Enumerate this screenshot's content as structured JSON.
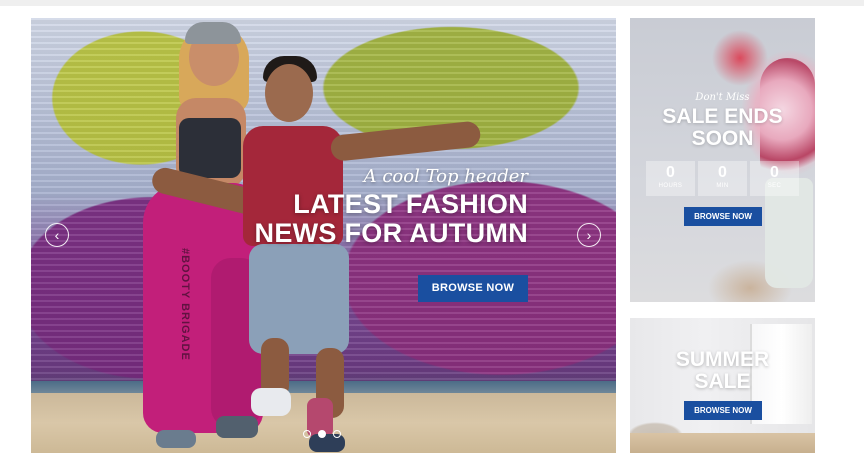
{
  "hero": {
    "subtitle": "A cool Top header",
    "title_line1": "LATEST FASHION",
    "title_line2": "NEWS FOR AUTUMN",
    "button_label": "BROWSE NOW",
    "leg_text": "#BOOTY BRIGADE",
    "prev_icon": "chevron-left-icon",
    "next_icon": "chevron-right-icon",
    "prev_glyph": "‹",
    "next_glyph": "›",
    "slides_total": 3,
    "active_slide": 2
  },
  "sale_banner": {
    "eyebrow": "Don't Miss",
    "title_line1": "SALE ENDS",
    "title_line2": "SOON",
    "countdown": [
      {
        "value": "0",
        "label": "HOURS"
      },
      {
        "value": "0",
        "label": "MIN"
      },
      {
        "value": "0",
        "label": "SEC"
      }
    ],
    "button_label": "BROWSE NOW"
  },
  "summer_banner": {
    "title_line1": "SUMMER",
    "title_line2": "SALE",
    "button_label": "BROWSE NOW"
  },
  "colors": {
    "accent": "#1a4fa0",
    "text_on_image": "#ffffff",
    "page_bg": "#ffffff"
  }
}
